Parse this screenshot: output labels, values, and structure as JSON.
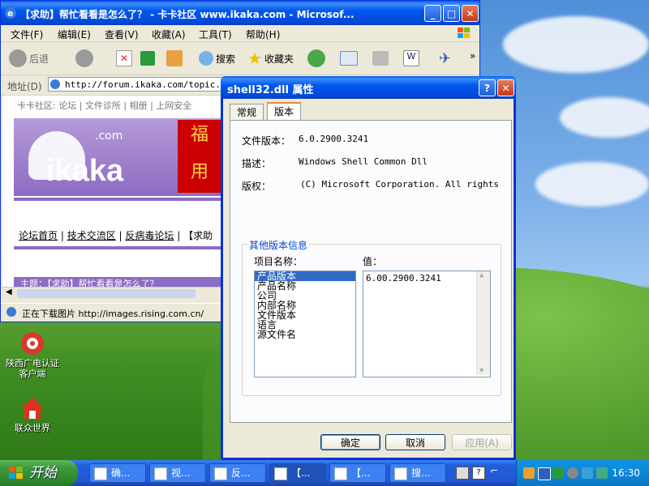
{
  "desktop": {
    "icons": [
      {
        "label_line1": "陕西广电认证",
        "label_line2": "客户端"
      },
      {
        "label_line1": "联众世界",
        "label_line2": ""
      }
    ]
  },
  "ie": {
    "title": "【求助】帮忙看看是怎么了？ - 卡卡社区 www.ikaka.com - Microsof...",
    "menu": [
      "文件(F)",
      "编辑(E)",
      "查看(V)",
      "收藏(A)",
      "工具(T)",
      "帮助(H)"
    ],
    "toolbar": {
      "back": "后退",
      "search": "搜索",
      "favorites": "收藏夹"
    },
    "address_label": "地址(D)",
    "address_value": "http://forum.ikaka.com/topic.asp",
    "page": {
      "topnav": "卡卡社区: 论坛 | 文件诊所 | 相册 | 上网安全",
      "logo": "ikaka",
      "logo_com": ".com",
      "banner_text": "福",
      "banner_text2": "用",
      "breadcrumb": [
        "论坛首页",
        "技术交流区",
        "反病毒论坛",
        "【求助"
      ],
      "topic_title": "主题：【求助】帮忙看看是怎么了？"
    },
    "status_text": "正在下载图片 http://images.rising.com.cn/"
  },
  "dialog": {
    "title": "shell32.dll 属性",
    "tabs": [
      "常规",
      "版本"
    ],
    "fields": [
      {
        "label": "文件版本：",
        "value": "6.0.2900.3241"
      },
      {
        "label": "描述：",
        "value": "Windows Shell Common Dll"
      },
      {
        "label": "版权：",
        "value": "(C) Microsoft Corporation. All rights rese"
      }
    ],
    "group_title": "其他版本信息",
    "item_name_label": "项目名称：",
    "value_label": "值：",
    "items": [
      "产品版本",
      "产品名称",
      "公司",
      "内部名称",
      "文件版本",
      "语言",
      "源文件名"
    ],
    "selected_value": "6.00.2900.3241",
    "buttons": {
      "ok": "确定",
      "cancel": "取消",
      "apply": "应用(A)"
    }
  },
  "taskbar": {
    "start": "开始",
    "tasks": [
      "确...",
      "视...",
      "反...",
      "【...",
      "【...",
      "搜..."
    ],
    "clock": "16:30"
  }
}
